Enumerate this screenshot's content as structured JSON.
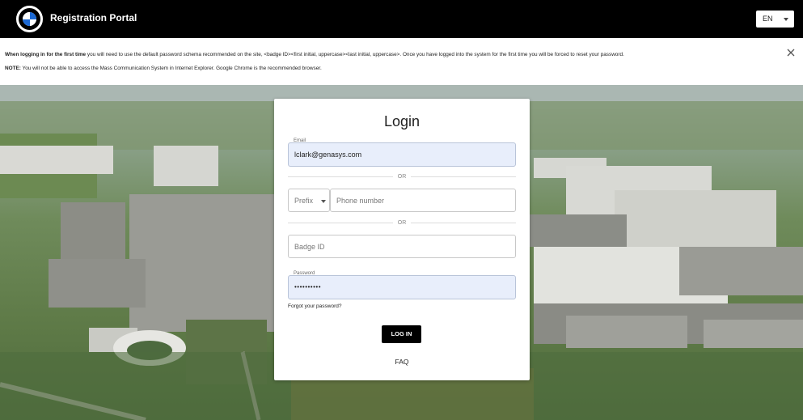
{
  "header": {
    "title": "Registration Portal",
    "logo_text": "BMW",
    "language": "EN"
  },
  "notice": {
    "line1_bold": "When logging in for the first time",
    "line1_rest": " you will need to use the default password schema recommended on the site, <badge ID><first initial, uppercase><last initial, uppercase>. Once you have logged into the system for the first time you will be forced to reset your password.",
    "line2_bold": "NOTE:",
    "line2_rest": " You will not be able to access the Mass Communication System in Internet Explorer. Google Chrome is the recommended browser."
  },
  "login": {
    "title": "Login",
    "email_label": "Email",
    "email_value": "lclark@genasys.com",
    "or1": "OR",
    "prefix_placeholder": "Prefix",
    "phone_placeholder": "Phone number",
    "or2": "OR",
    "badge_placeholder": "Badge ID",
    "password_label": "Password",
    "password_value": "••••••••••",
    "forgot": "Forgot your password?",
    "login_button": "LOG IN",
    "faq": "FAQ"
  },
  "colors": {
    "header_bg": "#000000",
    "filled_field_bg": "#e8eefb",
    "button_bg": "#000000"
  },
  "icons": {
    "close": "close-icon",
    "dropdown": "chevron-down-icon"
  }
}
